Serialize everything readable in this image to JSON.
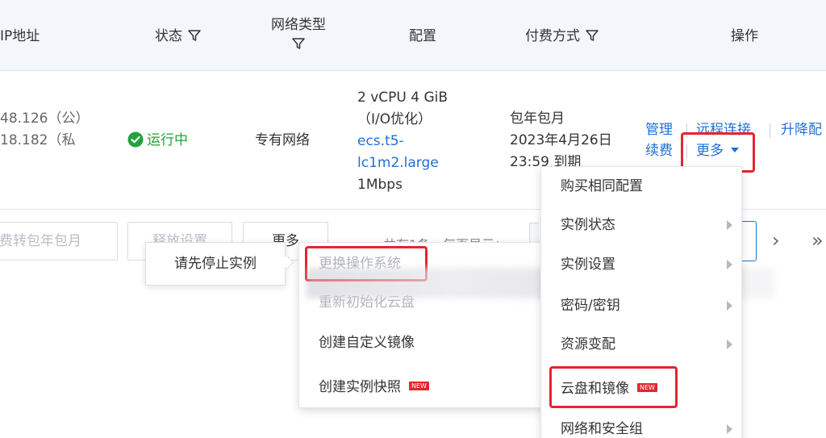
{
  "header": {
    "col_ip": "IP地址",
    "col_status": "状态",
    "col_network": "网络类型",
    "col_config": "配置",
    "col_billing": "付费方式",
    "col_actions": "操作"
  },
  "row": {
    "ip_public": "48.126（公）",
    "ip_private": "18.182（私",
    "status": "运行中",
    "network_type": "专有网络",
    "config_line1": "2 vCPU 4 GiB",
    "config_line2": "（I/O优化）",
    "instance_type_line1": "ecs.t5-",
    "instance_type_line2": "lc1m2.large",
    "bandwidth": "1Mbps",
    "billing_type": "包年包月",
    "expire_date": "2023年4月26日",
    "expire_time": "23:59 到期",
    "actions": {
      "manage": "管理",
      "remote_connect": "远程连接",
      "upgrade": "升降配",
      "renew": "续费",
      "more": "更多"
    }
  },
  "toolbar": {
    "convert_billing": "费转包年包月",
    "release_settings": "释放设置",
    "more": "更多",
    "pagination_text": "共有1条，每页显示：",
    "next": "›",
    "last": "»"
  },
  "tooltip": {
    "text": "请先停止实例"
  },
  "submenu": {
    "items": [
      {
        "label": "更换操作系统",
        "disabled": true
      },
      {
        "label": "重新初始化云盘",
        "disabled": true
      },
      {
        "label": "创建自定义镜像",
        "disabled": false
      },
      {
        "label": "创建实例快照",
        "disabled": false,
        "badge": "NEW"
      }
    ]
  },
  "more_menu": {
    "items": [
      {
        "label": "购买相同配置",
        "has_submenu": false
      },
      {
        "label": "实例状态",
        "has_submenu": true
      },
      {
        "label": "实例设置",
        "has_submenu": true
      },
      {
        "label": "密码/密钥",
        "has_submenu": true
      },
      {
        "label": "资源变配",
        "has_submenu": true
      },
      {
        "label": "云盘和镜像",
        "has_submenu": false,
        "badge": "NEW"
      },
      {
        "label": "网络和安全组",
        "has_submenu": true
      }
    ]
  },
  "colors": {
    "accent": "#1f6fd6",
    "running": "#21a33b",
    "highlight": "#e4262c"
  }
}
